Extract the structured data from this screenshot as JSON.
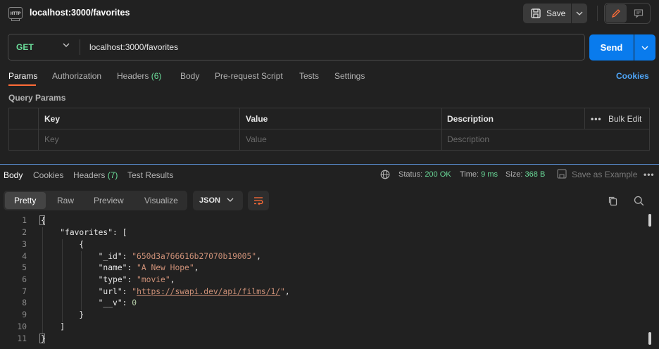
{
  "tab": {
    "title": "localhost:3000/favorites",
    "icon": "http-file-icon"
  },
  "toolbar": {
    "save_label": "Save"
  },
  "request": {
    "method": "GET",
    "url": "localhost:3000/favorites",
    "send_label": "Send"
  },
  "request_tabs": {
    "params": "Params",
    "authorization": "Authorization",
    "headers": "Headers",
    "headers_count": "(6)",
    "body": "Body",
    "prerequest": "Pre-request Script",
    "tests": "Tests",
    "settings": "Settings",
    "cookies": "Cookies"
  },
  "query_params": {
    "label": "Query Params",
    "headers": {
      "key": "Key",
      "value": "Value",
      "description": "Description"
    },
    "bulk_edit": "Bulk Edit",
    "placeholders": {
      "key": "Key",
      "value": "Value",
      "description": "Description"
    }
  },
  "response_tabs": {
    "body": "Body",
    "cookies": "Cookies",
    "headers": "Headers",
    "headers_count": "(7)",
    "test_results": "Test Results"
  },
  "response_meta": {
    "status_label": "Status:",
    "status_value": "200 OK",
    "time_label": "Time:",
    "time_value": "9 ms",
    "size_label": "Size:",
    "size_value": "368 B",
    "save_example": "Save as Example"
  },
  "view_modes": {
    "pretty": "Pretty",
    "raw": "Raw",
    "preview": "Preview",
    "visualize": "Visualize"
  },
  "format": "JSON",
  "code": {
    "line_numbers": [
      "1",
      "2",
      "3",
      "4",
      "5",
      "6",
      "7",
      "8",
      "9",
      "10",
      "11"
    ],
    "favorites_key": "\"favorites\"",
    "id_key": "\"_id\"",
    "id_val": "\"650d3a766616b27070b19005\"",
    "name_key": "\"name\"",
    "name_val": "\"A New Hope\"",
    "type_key": "\"type\"",
    "type_val": "\"movie\"",
    "url_key": "\"url\"",
    "url_val_q1": "\"",
    "url_val": "https://swapi.dev/api/films/1/",
    "url_val_q2": "\"",
    "v_key": "\"__v\"",
    "v_val": "0"
  },
  "colors": {
    "accent": "#ff6c37",
    "send": "#097bed",
    "ok": "#6bdd9a",
    "link": "#4ea4f5"
  }
}
